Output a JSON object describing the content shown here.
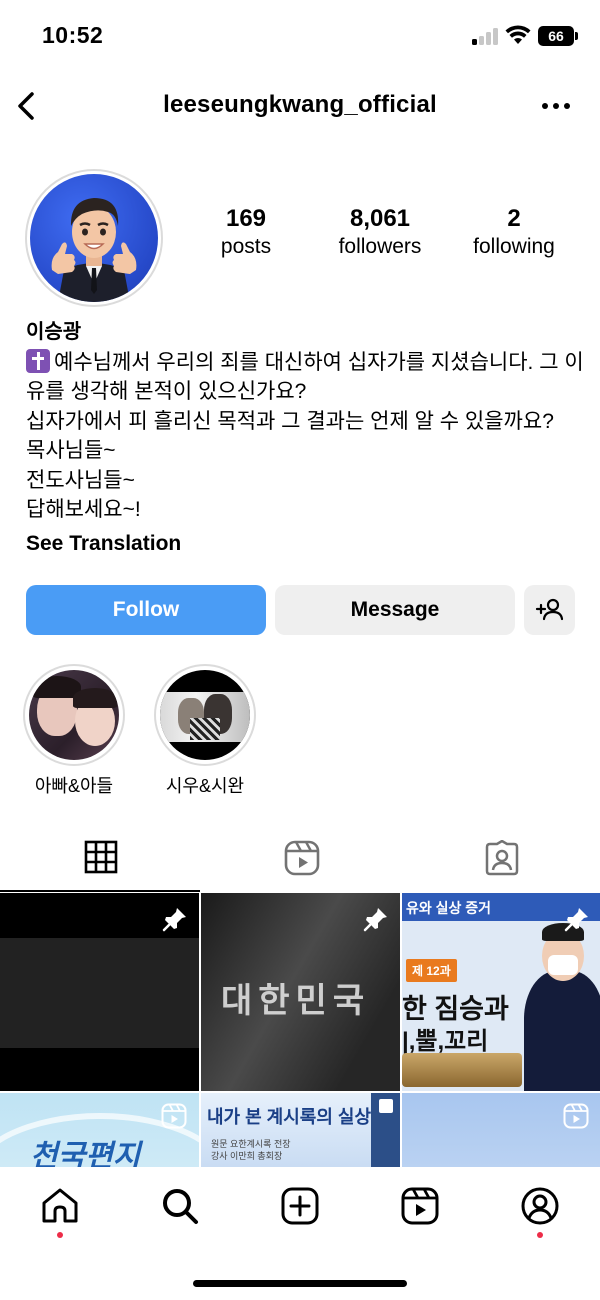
{
  "status_bar": {
    "time": "10:52",
    "battery": "66"
  },
  "header": {
    "username": "leeseungkwang_official"
  },
  "profile": {
    "stats": [
      {
        "value": "169",
        "label": "posts"
      },
      {
        "value": "8,061",
        "label": "followers"
      },
      {
        "value": "2",
        "label": "following"
      }
    ],
    "display_name": "이승광",
    "bio_lines": [
      "예수님께서 우리의 죄를 대신하여 십자가를 지셨습니다. 그 이유를 생각해 본적이 있으신가요?",
      "십자가에서 피 흘리신 목적과 그 결과는 언제 알 수 있을까요?",
      "목사님들~",
      "전도사님들~",
      "답해보세요~!"
    ],
    "see_translation": "See Translation"
  },
  "actions": {
    "follow_label": "Follow",
    "message_label": "Message"
  },
  "highlights": [
    {
      "label": "아빠&아들"
    },
    {
      "label": "시우&시완"
    }
  ],
  "posts": {
    "cell2_text": "대한민국",
    "cell3_top": "유와 실상 증거",
    "cell3_lesson": "제 12과",
    "cell3_line1": "한 짐승과",
    "cell3_line2": "|,뿔,꼬리",
    "cell4_text": "천국편지",
    "cell5_title": "내가 본 계시록의 실상",
    "cell5_sub1": "원문 요한계시록 전장",
    "cell5_sub2": "강사 이만희 총회장"
  },
  "colors": {
    "follow_blue": "#4a9cf5",
    "button_gray": "#efefef",
    "notification_red": "#ed2c48"
  },
  "icons": {
    "back": "chevron-left-icon",
    "more": "more-horizontal-icon",
    "add_user": "person-add-icon",
    "grid": "grid-icon",
    "reels": "reels-icon",
    "tagged": "tagged-icon",
    "home": "home-icon",
    "search": "search-icon",
    "create": "plus-square-icon",
    "profile": "profile-icon"
  }
}
